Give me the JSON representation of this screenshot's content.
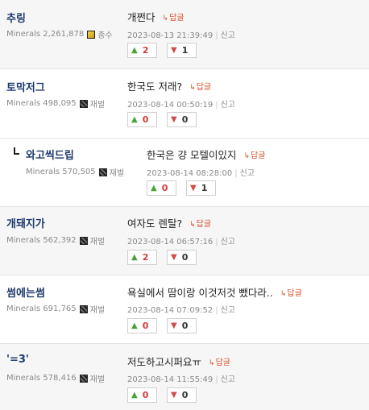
{
  "comments": [
    {
      "nick": "추링",
      "minerals": "Minerals 2,261,878",
      "rank": "종수",
      "content": "개쩐다",
      "reply": "답글",
      "date": "2023-08-13 21:39:49",
      "report": "신고",
      "up": "2",
      "down": "1"
    },
    {
      "nick": "토막저그",
      "minerals": "Minerals 498,095",
      "rank": "재벌",
      "content": "한국도 저래?",
      "reply": "답글",
      "date": "2023-08-14 00:50:19",
      "report": "신고",
      "up": "0",
      "down": "0"
    },
    {
      "nick": "와고씩드립",
      "minerals": "Minerals 570,505",
      "rank": "재벌",
      "content": "한국은 걍 모텔이있지",
      "reply": "답글",
      "date": "2023-08-14 08:28:00",
      "report": "신고",
      "up": "0",
      "down": "1"
    },
    {
      "nick": "개돼지가",
      "minerals": "Minerals 562,392",
      "rank": "재벌",
      "content": "여자도 렌탈?",
      "reply": "답글",
      "date": "2023-08-14 06:57:16",
      "report": "신고",
      "up": "2",
      "down": "0"
    },
    {
      "nick": "썸에는썸",
      "minerals": "Minerals 691,765",
      "rank": "재벌",
      "content": "욕실에서 땀이랑 이것저것 뺐다라..",
      "reply": "답글",
      "date": "2023-08-14 07:09:52",
      "report": "신고",
      "up": "0",
      "down": "0"
    },
    {
      "nick": "'=3'",
      "minerals": "Minerals 578,416",
      "rank": "재벌",
      "content": "저도하고시퍼요ㅠ",
      "reply": "답글",
      "date": "2023-08-14 11:55:49",
      "report": "신고",
      "up": "0",
      "down": "0"
    }
  ],
  "icons": {
    "upvote": "thumbs-up-icon",
    "downvote": "thumbs-down-icon",
    "reply": "reply-arrow-icon",
    "rank_gold": "gold-rank-icon",
    "rank_dark": "dark-rank-icon"
  }
}
